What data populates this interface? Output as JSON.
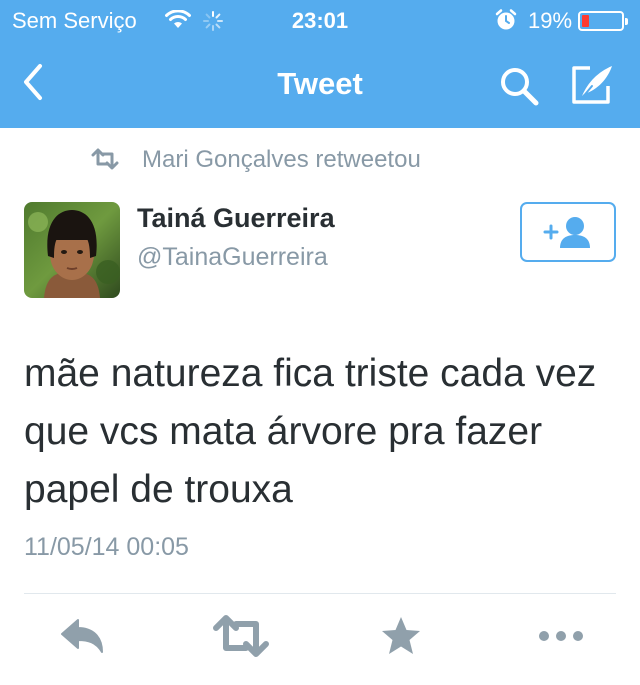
{
  "status_bar": {
    "carrier": "Sem Serviço",
    "time": "23:01",
    "battery_percent": "19%",
    "battery_level": 0.19,
    "icons": [
      "wifi-icon",
      "activity-spinner-icon",
      "alarm-icon",
      "battery-icon"
    ]
  },
  "nav": {
    "title": "Tweet",
    "icons": [
      "back-chevron-icon",
      "search-icon",
      "compose-icon"
    ]
  },
  "retweet_context": {
    "text": "Mari Gonçalves retweetou",
    "icon": "retweet-icon"
  },
  "tweet": {
    "author_name": "Tainá Guerreira",
    "author_handle": "@TainaGuerreira",
    "text": "mãe natureza fica triste cada vez que vcs mata árvore pra fazer papel de trouxa",
    "timestamp": "11/05/14 00:05"
  },
  "actions": [
    "reply-icon",
    "retweet-icon",
    "favorite-star-icon",
    "more-dots-icon"
  ],
  "colors": {
    "brand_blue": "#55acee",
    "text_dark": "#292f33",
    "text_gray": "#8899a6",
    "action_gray": "#90a0ab",
    "divider": "#e1e8ed",
    "battery_low": "#ff3b30"
  }
}
